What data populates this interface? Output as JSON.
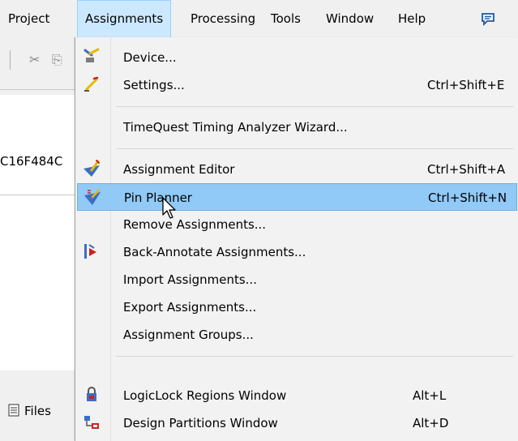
{
  "menubar": {
    "items": [
      "Project",
      "Assignments",
      "Processing",
      "Tools",
      "Window",
      "Help"
    ],
    "active": "Assignments",
    "extra_icon": "chat-bubble-icon"
  },
  "background": {
    "device_text": "C16F484C",
    "files_tab_label": "Files"
  },
  "assignments_menu": {
    "items": [
      {
        "label": "Device...",
        "shortcut": "",
        "icon": "device-icon"
      },
      {
        "label": "Settings...",
        "shortcut": "Ctrl+Shift+E",
        "icon": "settings-icon"
      },
      {
        "label": "TimeQuest Timing Analyzer Wizard...",
        "shortcut": "",
        "icon": ""
      },
      {
        "label": "Assignment Editor",
        "shortcut": "Ctrl+Shift+A",
        "icon": "assignment-editor-icon"
      },
      {
        "label": "Pin Planner",
        "shortcut": "Ctrl+Shift+N",
        "icon": "pin-planner-icon",
        "highlighted": true
      },
      {
        "label": "Remove Assignments...",
        "shortcut": "",
        "icon": ""
      },
      {
        "label": "Back-Annotate Assignments...",
        "shortcut": "",
        "icon": "back-annotate-icon"
      },
      {
        "label": "Import Assignments...",
        "shortcut": "",
        "icon": ""
      },
      {
        "label": "Export Assignments...",
        "shortcut": "",
        "icon": ""
      },
      {
        "label": "Assignment Groups...",
        "shortcut": "",
        "icon": ""
      },
      {
        "label": "LogicLock Regions Window",
        "shortcut": "Alt+L",
        "icon": "logiclock-icon"
      },
      {
        "label": "Design Partitions Window",
        "shortcut": "Alt+D",
        "icon": "design-partitions-icon"
      }
    ]
  },
  "colors": {
    "menubar_active": "#cce8ff",
    "item_highlight": "#91c9f7"
  }
}
